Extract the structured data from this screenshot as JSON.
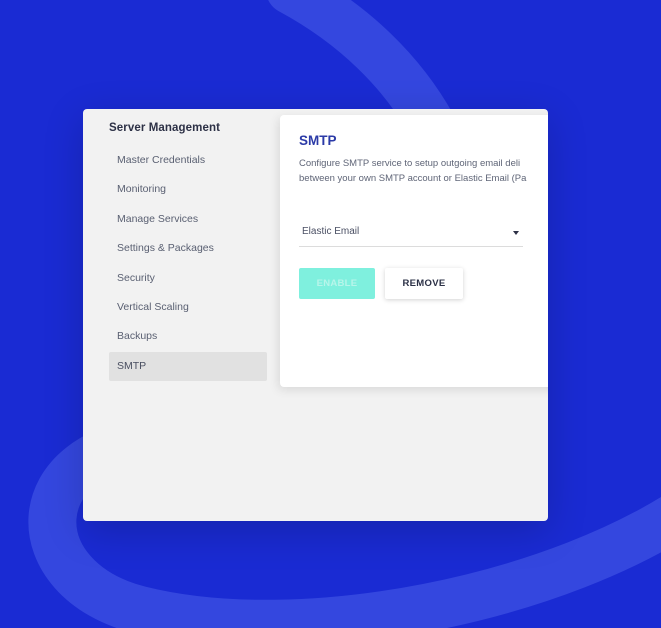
{
  "sidebar": {
    "title": "Server Management",
    "items": [
      {
        "label": "Master Credentials",
        "active": false
      },
      {
        "label": "Monitoring",
        "active": false
      },
      {
        "label": "Manage Services",
        "active": false
      },
      {
        "label": "Settings & Packages",
        "active": false
      },
      {
        "label": "Security",
        "active": false
      },
      {
        "label": "Vertical Scaling",
        "active": false
      },
      {
        "label": "Backups",
        "active": false
      },
      {
        "label": "SMTP",
        "active": true
      }
    ]
  },
  "smtp": {
    "title": "SMTP",
    "description_line1": "Configure SMTP service to setup outgoing email deli",
    "description_line2": "between your own SMTP account or Elastic Email (Pa",
    "provider_select": {
      "selected": "Elastic Email"
    },
    "enable_label": "ENABLE",
    "remove_label": "REMOVE"
  },
  "colors": {
    "background": "#1a2bd3",
    "accent_title": "#2b3aa7",
    "enable_button": "#7ff0de"
  }
}
